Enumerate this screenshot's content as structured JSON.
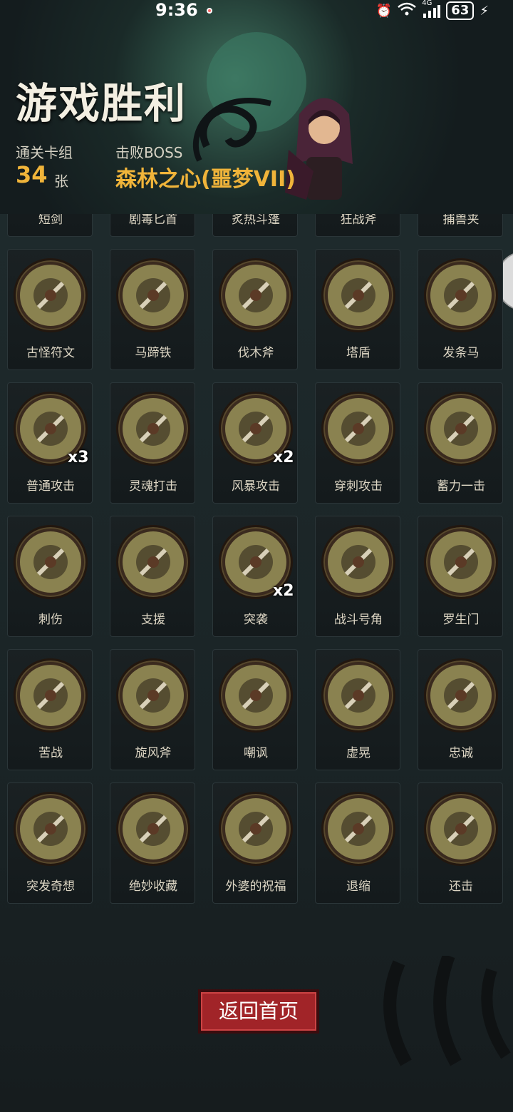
{
  "status_bar": {
    "time": "9:36",
    "network": "4G",
    "battery": "63"
  },
  "header": {
    "title": "游戏胜利",
    "cards_label": "通关卡组",
    "cards_count": "34",
    "cards_unit": "张",
    "boss_label": "击败BOSS",
    "boss_name": "森林之心(噩梦VII)"
  },
  "cards": [
    {
      "name": "短剑",
      "icon": "short-sword-icon",
      "color": "#8a8250"
    },
    {
      "name": "剧毒匕首",
      "icon": "poison-dagger-icon",
      "color": "#8a8250"
    },
    {
      "name": "炙热斗篷",
      "icon": "burning-cloak-icon",
      "color": "#8a8250"
    },
    {
      "name": "狂战斧",
      "icon": "berserker-axe-icon",
      "color": "#8a8250"
    },
    {
      "name": "捕兽夹",
      "icon": "bear-trap-icon",
      "color": "#8a8250"
    },
    {
      "name": "古怪符文",
      "icon": "strange-rune-icon",
      "color": "#8a8250"
    },
    {
      "name": "马蹄铁",
      "icon": "horseshoe-icon",
      "color": "#8a8250"
    },
    {
      "name": "伐木斧",
      "icon": "lumber-axe-icon",
      "color": "#8a8250"
    },
    {
      "name": "塔盾",
      "icon": "tower-shield-icon",
      "color": "#8a8250"
    },
    {
      "name": "发条马",
      "icon": "clockwork-horse-icon",
      "color": "#8a8250"
    },
    {
      "name": "普通攻击",
      "icon": "basic-attack-icon",
      "mult": "x3",
      "color": "#8a8250"
    },
    {
      "name": "灵魂打击",
      "icon": "soul-strike-icon",
      "color": "#8a8250"
    },
    {
      "name": "风暴攻击",
      "icon": "storm-attack-icon",
      "mult": "x2",
      "color": "#8a8250"
    },
    {
      "name": "穿刺攻击",
      "icon": "pierce-attack-icon",
      "color": "#8a8250"
    },
    {
      "name": "蓄力一击",
      "icon": "charged-strike-icon",
      "color": "#8a8250"
    },
    {
      "name": "刺伤",
      "icon": "stab-icon",
      "color": "#8a8250"
    },
    {
      "name": "支援",
      "icon": "support-icon",
      "color": "#8a8250"
    },
    {
      "name": "突袭",
      "icon": "raid-icon",
      "mult": "x2",
      "color": "#8a8250"
    },
    {
      "name": "战斗号角",
      "icon": "battle-horn-icon",
      "color": "#8a8250"
    },
    {
      "name": "罗生门",
      "icon": "rashomon-gate-icon",
      "color": "#8a8250"
    },
    {
      "name": "苦战",
      "icon": "hard-fight-icon",
      "color": "#8a8250"
    },
    {
      "name": "旋风斧",
      "icon": "whirlwind-axe-icon",
      "color": "#8a8250"
    },
    {
      "name": "嘲讽",
      "icon": "taunt-icon",
      "color": "#8a8250"
    },
    {
      "name": "虚晃",
      "icon": "feint-icon",
      "color": "#8a8250"
    },
    {
      "name": "忠诚",
      "icon": "loyalty-icon",
      "color": "#8a8250"
    },
    {
      "name": "突发奇想",
      "icon": "sudden-idea-icon",
      "color": "#8a8250"
    },
    {
      "name": "绝妙收藏",
      "icon": "great-collection-icon",
      "color": "#8a8250"
    },
    {
      "name": "外婆的祝福",
      "icon": "grandma-blessing-icon",
      "color": "#8a8250"
    },
    {
      "name": "退缩",
      "icon": "retreat-icon",
      "color": "#8a8250"
    },
    {
      "name": "还击",
      "icon": "counterattack-icon",
      "color": "#8a8250"
    }
  ],
  "footer": {
    "back_label": "返回首页"
  },
  "colors": {
    "accent_gold": "#f0b43a",
    "button_red": "#a12428",
    "medal_fill": "#8a8250"
  }
}
